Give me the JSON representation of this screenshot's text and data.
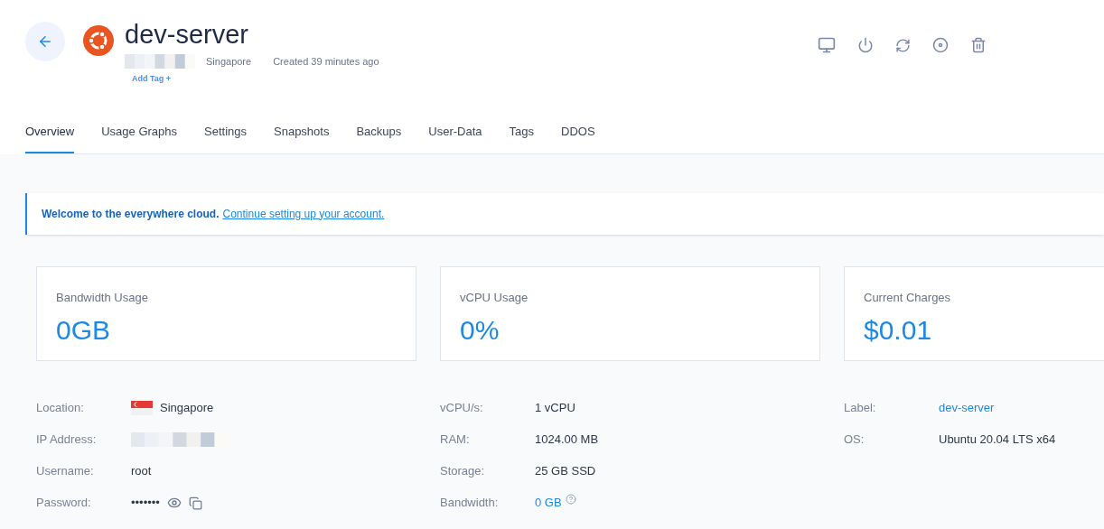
{
  "server": {
    "name": "dev-server",
    "location": "Singapore",
    "created": "Created 39 minutes ago",
    "add_tag": "Add Tag +"
  },
  "tabs": [
    {
      "label": "Overview",
      "selected": true
    },
    {
      "label": "Usage Graphs",
      "selected": false
    },
    {
      "label": "Settings",
      "selected": false
    },
    {
      "label": "Snapshots",
      "selected": false
    },
    {
      "label": "Backups",
      "selected": false
    },
    {
      "label": "User-Data",
      "selected": false
    },
    {
      "label": "Tags",
      "selected": false
    },
    {
      "label": "DDOS",
      "selected": false
    }
  ],
  "banner": {
    "text": "Welcome to the everywhere cloud.",
    "link": "Continue setting up your account."
  },
  "stats": [
    {
      "label": "Bandwidth Usage",
      "value": "0GB"
    },
    {
      "label": "vCPU Usage",
      "value": "0%"
    },
    {
      "label": "Current Charges",
      "value": "$0.01"
    }
  ],
  "details": [
    [
      {
        "label": "Location:",
        "kind": "flag",
        "value": "Singapore"
      },
      {
        "label": "IP Address:",
        "kind": "blurred"
      },
      {
        "label": "Username:",
        "kind": "text",
        "value": "root"
      },
      {
        "label": "Password:",
        "kind": "password",
        "value": "•••••••"
      }
    ],
    [
      {
        "label": "vCPU/s:",
        "kind": "text",
        "value": "1 vCPU"
      },
      {
        "label": "RAM:",
        "kind": "text",
        "value": "1024.00 MB"
      },
      {
        "label": "Storage:",
        "kind": "text",
        "value": "25 GB SSD"
      },
      {
        "label": "Bandwidth:",
        "kind": "help-link",
        "value": "0 GB"
      }
    ],
    [
      {
        "label": "Label:",
        "kind": "link",
        "value": "dev-server"
      },
      {
        "label": "OS:",
        "kind": "text",
        "value": "Ubuntu 20.04 LTS x64"
      }
    ]
  ]
}
